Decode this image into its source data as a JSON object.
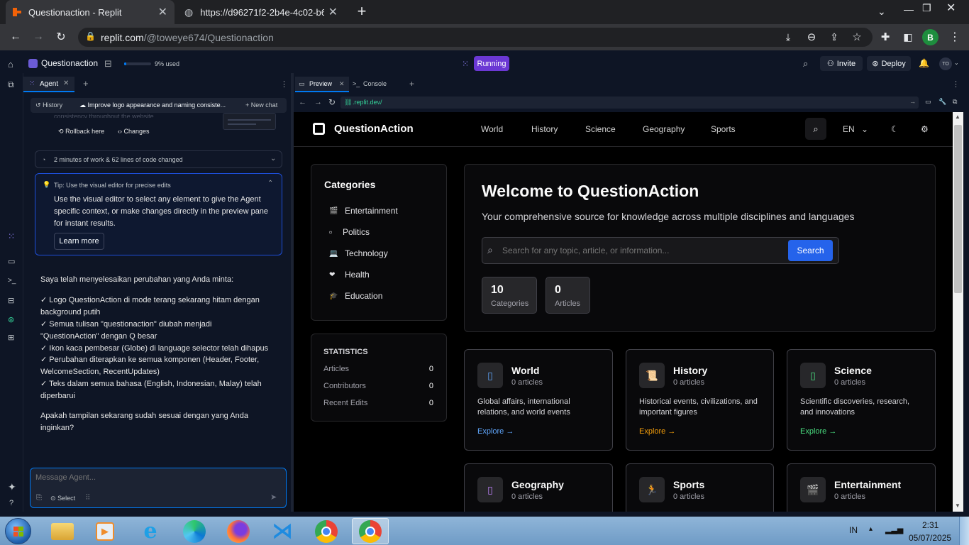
{
  "browser": {
    "tabs": [
      {
        "title": "Questionaction - Replit",
        "favicon_color": "#f26207"
      },
      {
        "title": "https://d96271f2-2b4e-4c02-b60",
        "favicon_color": "#bdc1c6"
      }
    ],
    "new_tab": "+",
    "url_host": "replit.com",
    "url_path": "/@toweye674/Questionaction",
    "profile_initial": "B"
  },
  "replit": {
    "project_name": "Questionaction",
    "usage": "9% used",
    "usage_fraction": 0.09,
    "run_status": "Running",
    "invite": "Invite",
    "deploy": "Deploy",
    "user_initials": "TO",
    "agent_tab": "Agent",
    "preview_tab": "Preview",
    "console_tab": "Console",
    "preview_url": ".replit.dev/"
  },
  "agent": {
    "history": "History",
    "chat_title": "Improve logo appearance and naming consiste...",
    "new_chat": "New chat",
    "faded_line": "consistency throughout the website",
    "rollback": "Rollback here",
    "changes": "Changes",
    "work_summary": "2 minutes of work & 62 lines of code changed",
    "tip_title": "Tip: Use the visual editor for precise edits",
    "tip_body": "Use the visual editor to select any element to give the Agent specific context, or make changes directly in the preview pane for instant results.",
    "learn_more": "Learn more",
    "messages": [
      "Saya telah menyelesaikan perubahan yang Anda minta:",
      "✓ Logo QuestionAction di mode terang sekarang hitam dengan background putih",
      "✓ Semua tulisan \"questionaction\" diubah menjadi \"QuestionAction\" dengan Q besar",
      "✓ Ikon kaca pembesar (Globe) di language selector telah dihapus",
      "✓ Perubahan diterapkan ke semua komponen (Header, Footer, WelcomeSection, RecentUpdates)",
      "✓ Teks dalam semua bahasa (English, Indonesian, Malay) telah diperbarui",
      "Apakah tampilan sekarang sudah sesuai dengan yang Anda inginkan?"
    ],
    "input_placeholder": "Message Agent...",
    "select": "Select"
  },
  "site": {
    "logo": "QuestionAction",
    "nav": [
      "World",
      "History",
      "Science",
      "Geography",
      "Sports"
    ],
    "lang": "EN",
    "categories_title": "Categories",
    "categories": [
      {
        "icon": "clapper-icon",
        "glyph": "🎬",
        "label": "Entertainment"
      },
      {
        "icon": "box-icon",
        "glyph": "▫",
        "label": "Politics"
      },
      {
        "icon": "laptop-icon",
        "glyph": "💻",
        "label": "Technology"
      },
      {
        "icon": "heart-icon",
        "glyph": "❤",
        "label": "Health"
      },
      {
        "icon": "graduation-cap-icon",
        "glyph": "🎓",
        "label": "Education"
      }
    ],
    "stats_title": "STATISTICS",
    "stats": [
      {
        "label": "Articles",
        "value": "0"
      },
      {
        "label": "Contributors",
        "value": "0"
      },
      {
        "label": "Recent Edits",
        "value": "0"
      }
    ],
    "welcome_title": "Welcome to QuestionAction",
    "welcome_sub": "Your comprehensive source for knowledge across multiple disciplines and languages",
    "search_placeholder": "Search for any topic, article, or information...",
    "search_button": "Search",
    "counters": [
      {
        "value": "10",
        "label": "Categories"
      },
      {
        "value": "0",
        "label": "Articles"
      }
    ],
    "cards": [
      {
        "title": "World",
        "sub": "0 articles",
        "desc": "Global affairs, international relations, and world events",
        "explore": "Explore",
        "accent": "#60a5fa",
        "icon": "globe-icon",
        "glyph": "▯"
      },
      {
        "title": "History",
        "sub": "0 articles",
        "desc": "Historical events, civilizations, and important figures",
        "explore": "Explore",
        "accent": "#f59e0b",
        "icon": "scroll-icon",
        "glyph": "📜"
      },
      {
        "title": "Science",
        "sub": "0 articles",
        "desc": "Scientific discoveries, research, and innovations",
        "explore": "Explore",
        "accent": "#4ade80",
        "icon": "flask-icon",
        "glyph": "▯"
      },
      {
        "title": "Geography",
        "sub": "0 articles",
        "desc": "",
        "explore": "",
        "accent": "#c084fc",
        "icon": "map-icon",
        "glyph": "▯"
      },
      {
        "title": "Sports",
        "sub": "0 articles",
        "desc": "",
        "explore": "",
        "accent": "#f87171",
        "icon": "runner-icon",
        "glyph": "🏃"
      },
      {
        "title": "Entertainment",
        "sub": "0 articles",
        "desc": "",
        "explore": "",
        "accent": "#f472b6",
        "icon": "clapper-icon",
        "glyph": "🎬"
      }
    ]
  },
  "taskbar": {
    "lang": "IN",
    "time": "2:31",
    "date": "05/07/2025"
  }
}
